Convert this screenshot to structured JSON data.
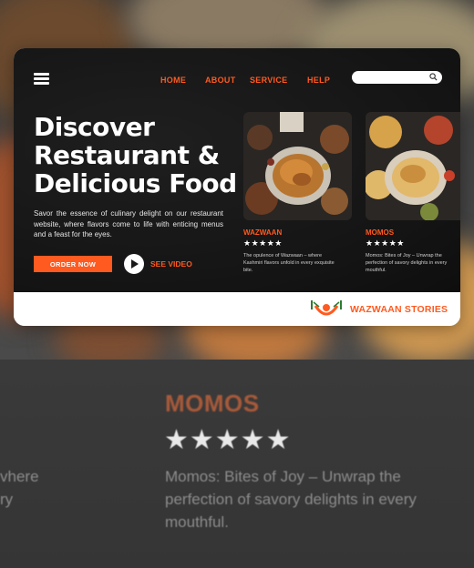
{
  "nav": {
    "items": [
      "HOME",
      "ABOUT",
      "SERVICE",
      "HELP"
    ]
  },
  "search": {
    "placeholder": ""
  },
  "hero": {
    "headline_line1": "Discover",
    "headline_line2": "Restaurant &",
    "headline_line3": "Delicious Food",
    "lead": "Savor the essence of culinary delight on our restaurant website, where flavors come to life with enticing menus and a feast for the eyes.",
    "order_button": "ORDER NOW",
    "see_video": "SEE VIDEO"
  },
  "dishes": [
    {
      "name": "WAZWAAN",
      "stars": "★★★★★",
      "desc": "The opulence of Wazwaan – where Kashmiri flavors unfold in every exquisite bite."
    },
    {
      "name": "MOMOS",
      "stars": "★★★★★",
      "desc": "Momos: Bites of Joy – Unwrap the perfection of savory delights in every mouthful."
    }
  ],
  "footer": {
    "brand": "WAZWAAN STORIES"
  },
  "background": {
    "title": "MOMOS",
    "stars": "★★★★★",
    "desc": "Momos: Bites of Joy – Unwrap the perfection of savory delights in every mouthful.",
    "left_line1": "vhere",
    "left_line2": "ry"
  },
  "colors": {
    "accent": "#ff5a1f",
    "hero_bg": "#141414",
    "footer_bg": "#ffffff"
  },
  "icons": [
    "menu-icon",
    "search-icon",
    "play-icon",
    "chef-logo-icon"
  ]
}
